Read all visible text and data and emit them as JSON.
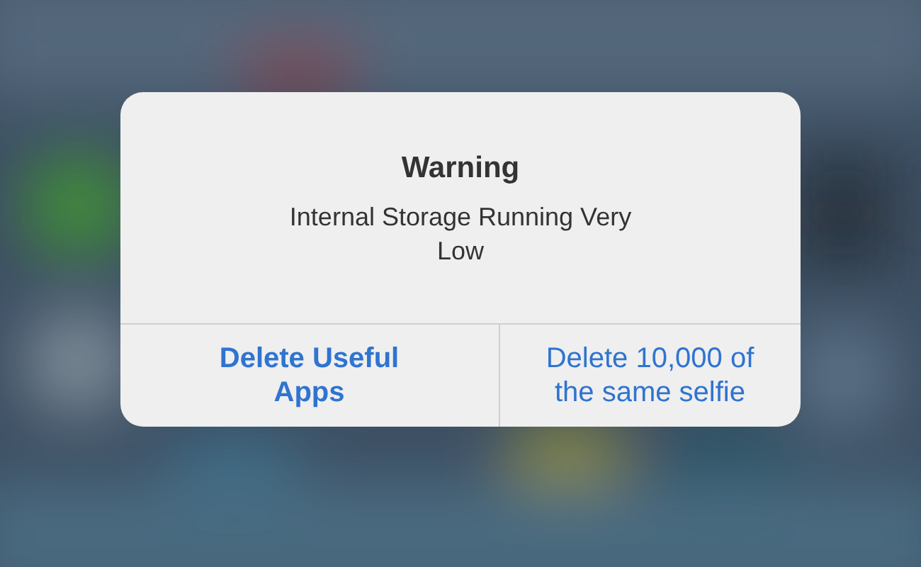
{
  "alert": {
    "title": "Warning",
    "message": "Internal Storage Running Very Low",
    "buttons": [
      {
        "label": "Delete Useful Apps",
        "preferred": true
      },
      {
        "label": "Delete 10,000 of the same selfie",
        "preferred": false
      }
    ]
  }
}
